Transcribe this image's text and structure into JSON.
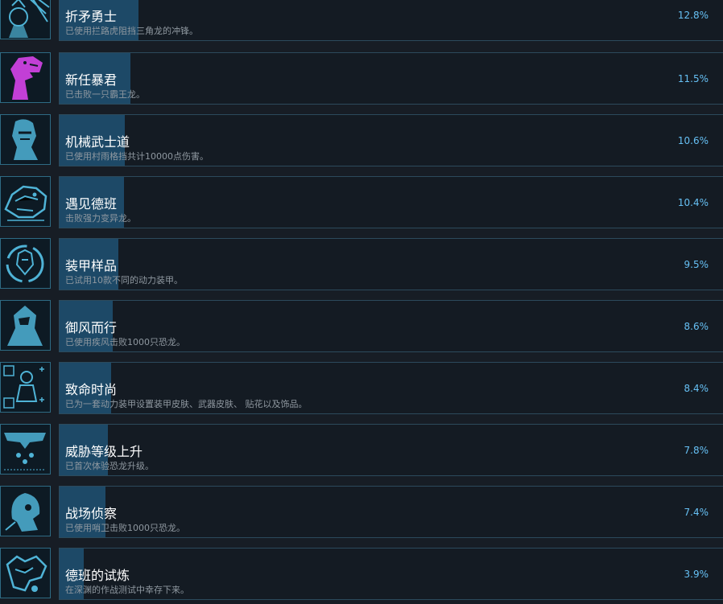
{
  "achievements": [
    {
      "title": "折矛勇士",
      "desc": "已使用拦路虎阻挡三角龙的冲锋。",
      "percent_text": "12.8%",
      "percent": 12.8,
      "icon": "warrior-spear-icon",
      "icon_color": "#4fb3d6"
    },
    {
      "title": "新任暴君",
      "desc": "已击败一只霸王龙。",
      "percent_text": "11.5%",
      "percent": 11.5,
      "icon": "tyrant-rex-icon",
      "icon_color": "#c23fd6"
    },
    {
      "title": "机械武士道",
      "desc": "已使用村雨格挡共计10000点伤害。",
      "percent_text": "10.6%",
      "percent": 10.6,
      "icon": "mech-samurai-icon",
      "icon_color": "#4fb3d6"
    },
    {
      "title": "遇见德班",
      "desc": "击败强力变异龙。",
      "percent_text": "10.4%",
      "percent": 10.4,
      "icon": "mutant-dino-icon",
      "icon_color": "#4fb3d6"
    },
    {
      "title": "装甲样品",
      "desc": "已试用10款不同的动力装甲。",
      "percent_text": "9.5%",
      "percent": 9.5,
      "icon": "armor-cycle-icon",
      "icon_color": "#4fb3d6"
    },
    {
      "title": "御风而行",
      "desc": "已使用疾风击败1000只恐龙。",
      "percent_text": "8.6%",
      "percent": 8.6,
      "icon": "wind-rider-icon",
      "icon_color": "#4fb3d6"
    },
    {
      "title": "致命时尚",
      "desc": "已为一套动力装甲设置装甲皮肤、武器皮肤、 贴花以及饰品。",
      "percent_text": "8.4%",
      "percent": 8.4,
      "icon": "fashion-armor-icon",
      "icon_color": "#4fb3d6"
    },
    {
      "title": "威胁等级上升",
      "desc": "已首次体验恐龙升级。",
      "percent_text": "7.8%",
      "percent": 7.8,
      "icon": "threat-level-icon",
      "icon_color": "#4fb3d6"
    },
    {
      "title": "战场侦察",
      "desc": "已使用哨卫击败1000只恐龙。",
      "percent_text": "7.4%",
      "percent": 7.4,
      "icon": "sentinel-scout-icon",
      "icon_color": "#4fb3d6"
    },
    {
      "title": "德班的试炼",
      "desc": "在深渊的作战测试中幸存下来。",
      "percent_text": "3.9%",
      "percent": 3.9,
      "icon": "trial-icon",
      "icon_color": "#4fb3d6"
    }
  ]
}
